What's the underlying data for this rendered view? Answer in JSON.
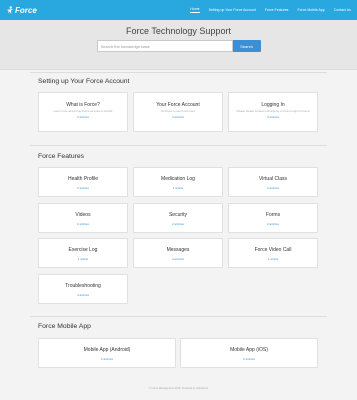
{
  "brand": {
    "logo_text": "Force"
  },
  "nav": [
    {
      "label": "Home",
      "active": true
    },
    {
      "label": "Setting up Your Force Account",
      "active": false
    },
    {
      "label": "Force Features",
      "active": false
    },
    {
      "label": "Force Mobile App",
      "active": false
    },
    {
      "label": "Contact Us",
      "active": false
    }
  ],
  "hero": {
    "title": "Force Technology Support",
    "search_placeholder": "Search the knowledge base",
    "search_button": "Search"
  },
  "sections": [
    {
      "title": "Setting up Your Force Account",
      "cards": [
        {
          "title": "What is Force?",
          "desc": "Learn more about how Force as extra to benefit",
          "count": "3 articles"
        },
        {
          "title": "Your Force Account",
          "desc": "Find how to use Force here",
          "count": "4 articles"
        },
        {
          "title": "Logging In",
          "desc": "Please please contact instructions on how to login to Force",
          "count": "3 articles"
        }
      ]
    },
    {
      "title": "Force Features",
      "cards": [
        {
          "title": "Health Profile",
          "count": "2 articles"
        },
        {
          "title": "Medication Log",
          "count": "1 article"
        },
        {
          "title": "Virtual Class",
          "count": "3 articles"
        },
        {
          "title": "Videos",
          "count": "2 articles"
        },
        {
          "title": "Security",
          "count": "2 articles"
        },
        {
          "title": "Forms",
          "count": "2 articles"
        },
        {
          "title": "Exercise Log",
          "count": "1 article"
        },
        {
          "title": "Messages",
          "count": "4 articles"
        },
        {
          "title": "Force Video Call",
          "count": "1 article"
        },
        {
          "title": "Troubleshooting",
          "count": "4 articles"
        }
      ]
    },
    {
      "title": "Force Mobile App",
      "cards": [
        {
          "title": "Mobile App (Android)",
          "count": "6 articles"
        },
        {
          "title": "Mobile App (iOS)",
          "count": "6 articles"
        }
      ]
    }
  ],
  "footer": {
    "text": "© Force Management 2019. Powered by HelpScout"
  },
  "colors": {
    "topbar": "#29a7df",
    "accent": "#3a9bd9",
    "search_button": "#3d8fd3"
  }
}
